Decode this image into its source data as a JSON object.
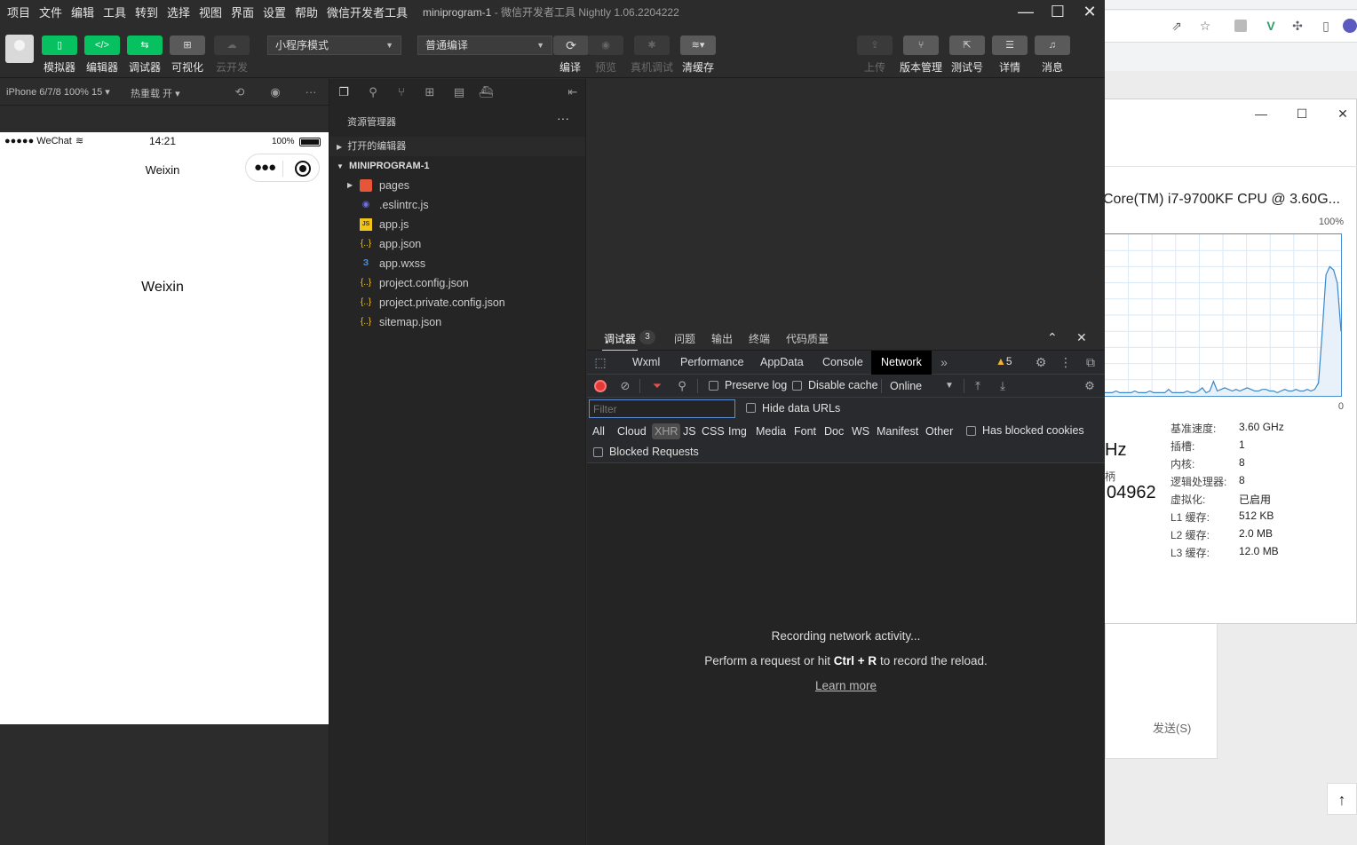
{
  "browser": {
    "toolbar_icons": [
      "share-icon",
      "star-icon",
      "extension-icon",
      "vue-devtools-icon",
      "puzzle-icon",
      "sidebar-icon",
      "profile-icon"
    ],
    "send_label": "发送(S)",
    "scroll_top_icon": "arrow-up-icon"
  },
  "taskmgr": {
    "cpu_name": "Core(TM) i7-9700KF CPU @ 3.60G...",
    "y_max": "100%",
    "y_min": "0",
    "partial_speed": "Hz",
    "partial_handles": "柄",
    "partial_number": "04962",
    "specs": [
      {
        "key": "基准速度:",
        "value": "3.60 GHz"
      },
      {
        "key": "插槽:",
        "value": "1"
      },
      {
        "key": "内核:",
        "value": "8"
      },
      {
        "key": "逻辑处理器:",
        "value": "8"
      },
      {
        "key": "虚拟化:",
        "value": "已启用"
      },
      {
        "key": "L1 缓存:",
        "value": "512 KB"
      },
      {
        "key": "L2 缓存:",
        "value": "2.0 MB"
      },
      {
        "key": "L3 缓存:",
        "value": "12.0 MB"
      }
    ],
    "utilization": [
      2,
      2,
      2,
      3,
      2,
      2,
      2,
      2,
      3,
      2,
      2,
      2,
      3,
      2,
      2,
      2,
      2,
      4,
      2,
      2,
      2,
      2,
      3,
      2,
      2,
      3,
      5,
      2,
      3,
      9,
      3,
      4,
      5,
      4,
      3,
      4,
      3,
      4,
      5,
      4,
      3,
      3,
      4,
      4,
      3,
      3,
      2,
      3,
      4,
      3,
      3,
      4,
      3,
      3,
      4,
      3,
      4,
      8,
      40,
      75,
      80,
      78,
      70,
      40
    ]
  },
  "ide": {
    "menu": [
      "项目",
      "文件",
      "编辑",
      "工具",
      "转到",
      "选择",
      "视图",
      "界面",
      "设置",
      "帮助",
      "微信开发者工具"
    ],
    "title_project": "miniprogram-1",
    "title_rest": " - 微信开发者工具 Nightly 1.06.2204222",
    "toolbar": {
      "simulator": "模拟器",
      "editor": "编辑器",
      "debugger": "调试器",
      "visual": "可视化",
      "cloud": "云开发",
      "mode_select": "小程序模式",
      "compile_select": "普通编译",
      "compile": "编译",
      "preview": "预览",
      "real_debug": "真机调试",
      "clear_cache": "清缓存",
      "upload": "上传",
      "version": "版本管理",
      "test_account": "测试号",
      "details": "详情",
      "messages": "消息"
    },
    "simulator": {
      "device": "iPhone 6/7/8 100% 15 ▾",
      "hot_reload": "热重载 开 ▾",
      "carrier": "●●●●● WeChat",
      "time": "14:21",
      "battery": "100%",
      "nav_title": "Weixin",
      "body_text": "Weixin"
    },
    "explorer": {
      "title": "资源管理器",
      "more": "···",
      "open_editors": "打开的编辑器",
      "project": "MINIPROGRAM-1",
      "files": [
        {
          "name": "pages",
          "type": "folder"
        },
        {
          "name": ".eslintrc.js",
          "type": "eslint"
        },
        {
          "name": "app.js",
          "type": "js"
        },
        {
          "name": "app.json",
          "type": "json"
        },
        {
          "name": "app.wxss",
          "type": "css"
        },
        {
          "name": "project.config.json",
          "type": "json"
        },
        {
          "name": "project.private.config.json",
          "type": "json"
        },
        {
          "name": "sitemap.json",
          "type": "json"
        }
      ]
    },
    "debugger": {
      "tabs": [
        "调试器",
        "问题",
        "输出",
        "终端",
        "代码质量"
      ],
      "badge": "3",
      "devtools_tabs": [
        "Wxml",
        "Performance",
        "AppData",
        "Console",
        "Network"
      ],
      "active_tab": "Network",
      "more_tabs": "»",
      "warnings": "5",
      "preserve_log": "Preserve log",
      "disable_cache": "Disable cache",
      "throttle": "Online",
      "filter_placeholder": "Filter",
      "hide_data_urls": "Hide data URLs",
      "types": [
        "All",
        "Cloud",
        "XHR",
        "JS",
        "CSS",
        "Img",
        "Media",
        "Font",
        "Doc",
        "WS",
        "Manifest",
        "Other"
      ],
      "selected_type": "XHR",
      "has_blocked_cookies": "Has blocked cookies",
      "blocked_requests": "Blocked Requests",
      "empty_line1": "Recording network activity...",
      "empty_line2_pre": "Perform a request or hit ",
      "empty_line2_keys": "Ctrl + R",
      "empty_line2_post": " to record the reload.",
      "learn_more": "Learn more"
    }
  }
}
